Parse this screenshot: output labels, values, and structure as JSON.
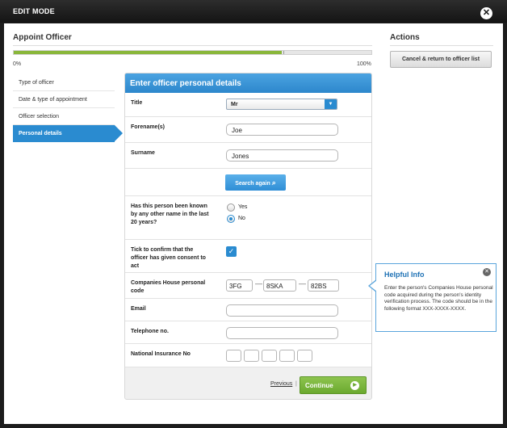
{
  "window": {
    "title": "EDIT MODE",
    "close_icon": "close-icon",
    "close_glyph": "✕"
  },
  "left": {
    "heading": "Appoint Officer",
    "progress": {
      "value_percent": 75,
      "min_label": "0%",
      "max_label": "100%"
    },
    "steps": [
      {
        "label": "Type of officer",
        "active": false
      },
      {
        "label": "Date & type of appointment",
        "active": false
      },
      {
        "label": "Officer selection",
        "active": false
      },
      {
        "label": "Personal details",
        "active": true
      }
    ]
  },
  "form": {
    "header": "Enter officer personal details",
    "title": {
      "label": "Title",
      "value": "Mr",
      "dropdown_glyph": "▼"
    },
    "forename": {
      "label": "Forename(s)",
      "value": "Joe"
    },
    "surname": {
      "label": "Surname",
      "value": "Jones"
    },
    "search_again": {
      "label": "Search again",
      "icon": "search-icon",
      "glyph": "⌕"
    },
    "known_by_other_name": {
      "label": "Has this person been known by any other name in the last 20 years?",
      "options": [
        {
          "label": "Yes",
          "checked": false
        },
        {
          "label": "No",
          "checked": true
        }
      ]
    },
    "consent": {
      "label": "Tick to confirm that the officer has given consent to act",
      "checked": true,
      "glyph": "✓"
    },
    "personal_code": {
      "label": "Companies House personal code",
      "parts": [
        "3FG",
        "8SKA",
        "82BS"
      ],
      "separator": "—"
    },
    "email": {
      "label": "Email",
      "value": ""
    },
    "telephone": {
      "label": "Telephone no.",
      "value": ""
    },
    "national_insurance": {
      "label": "National Insurance No",
      "boxes": 5
    },
    "footer": {
      "previous_label": "Previous",
      "separator": "|",
      "continue_label": "Continue",
      "continue_icon": "arrow-right-icon",
      "continue_glyph": "▶"
    }
  },
  "actions": {
    "heading": "Actions",
    "cancel_label": "Cancel & return to officer list"
  },
  "helpful_info": {
    "title": "Helpful Info",
    "close_glyph": "✕",
    "text": "Enter the person's Companies House personal code acquired during the person's identity verification process. The code should be in the following format XXX-XXXX-XXXX."
  },
  "colors": {
    "accent_blue": "#2a8bd0",
    "progress_green": "#8ab73b",
    "continue_green": "#6ba92f",
    "frame_dark": "#1c1c1c"
  }
}
